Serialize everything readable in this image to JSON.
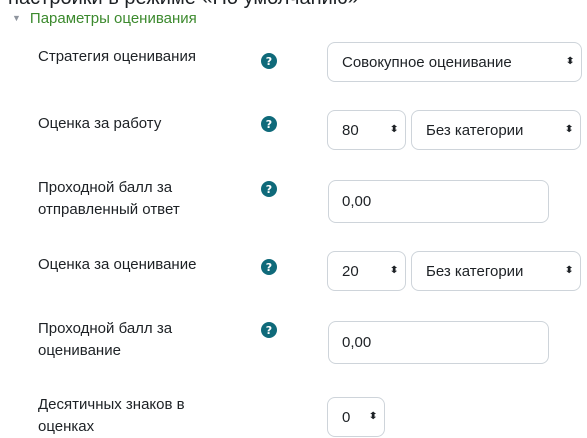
{
  "page_header_fragment": "настройки в режиме «По умолчанию»",
  "section": {
    "title": "Параметры оценивания"
  },
  "fields": {
    "strategy": {
      "label": "Стратегия оценивания",
      "value": "Совокупное оценивание"
    },
    "submission_grade": {
      "label": "Оценка за работу",
      "value": "80",
      "category": "Без категории"
    },
    "submission_pass": {
      "label_line1": "Проходной балл за",
      "label_line2": "отправленный ответ",
      "value": "0,00"
    },
    "assessment_grade": {
      "label": "Оценка за оценивание",
      "value": "20",
      "category": "Без категории"
    },
    "assessment_pass": {
      "label_line1": "Проходной балл за",
      "label_line2": "оценивание",
      "value": "0,00"
    },
    "decimals": {
      "label_line1": "Десятичных знаков в",
      "label_line2": "оценках",
      "value": "0"
    }
  },
  "icons": {
    "help": "?",
    "select_arrows": "⬍",
    "collapse_caret": "▼"
  },
  "colors": {
    "section_link": "#3c8a2e",
    "help_icon": "#0f6a7a",
    "border": "#ced4da"
  }
}
